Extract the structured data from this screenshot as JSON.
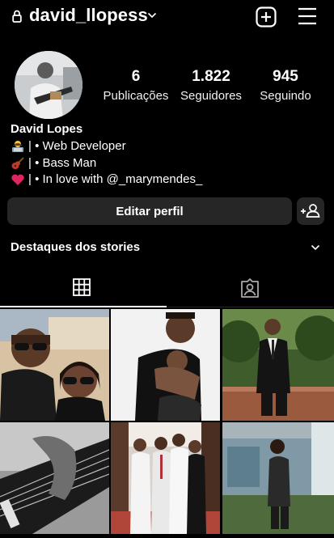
{
  "header": {
    "username": "david_llopess"
  },
  "profile": {
    "display_name": "David Lopes",
    "stats": [
      {
        "value": "6",
        "label": "Publicações"
      },
      {
        "value": "1.822",
        "label": "Seguidores"
      },
      {
        "value": "945",
        "label": "Seguindo"
      }
    ],
    "bio": [
      {
        "icon": "technologist-emoji-icon",
        "text": "| • Web Developer"
      },
      {
        "icon": "guitar-emoji-icon",
        "text": "| • Bass Man"
      },
      {
        "icon": "red-heart-emoji-icon",
        "text": "| • In love with @_marymendes_"
      }
    ]
  },
  "actions": {
    "edit_profile": "Editar perfil"
  },
  "highlights": {
    "title": "Destaques dos stories"
  },
  "tabs": [
    {
      "name": "posts-grid",
      "icon": "grid-icon",
      "active": true
    },
    {
      "name": "tagged",
      "icon": "tagged-person-icon",
      "active": false
    }
  ],
  "posts": [
    {
      "name": "selfie-couple-sunglasses"
    },
    {
      "name": "holding-baby"
    },
    {
      "name": "suit-outdoor-garden"
    },
    {
      "name": "bass-guitar-closeup-bw"
    },
    {
      "name": "group-wedding-photo"
    },
    {
      "name": "standing-outdoor-night"
    }
  ],
  "colors": {
    "background": "#000000",
    "button": "#262626",
    "text": "#ffffff"
  }
}
